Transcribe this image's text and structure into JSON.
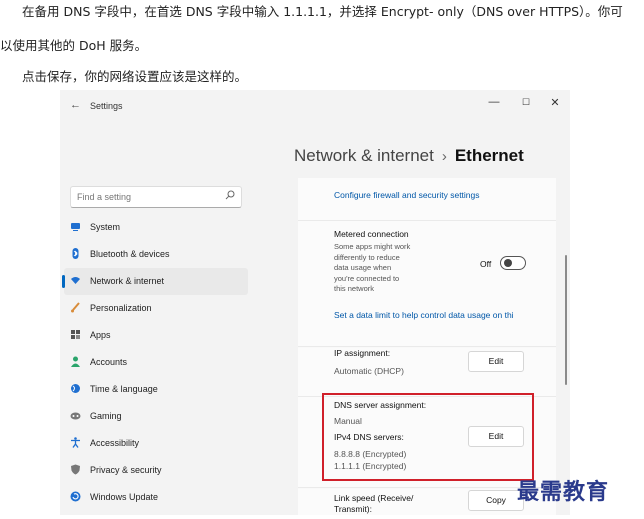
{
  "article": {
    "line1": "在备用 DNS 字段中，在首选 DNS 字段中输入 1.1.1.1，并选择 Encrypt- only（DNS over HTTPS）。你可",
    "line2": "以使用其他的 DoH 服务。",
    "line3": "点击保存，你的网络设置应该是这样的。"
  },
  "window": {
    "back_glyph": "←",
    "title": "Settings",
    "controls": {
      "minimize": "—",
      "maximize": "☐",
      "close": "✕"
    }
  },
  "breadcrumb": {
    "parent": "Network & internet",
    "separator": "›",
    "current": "Ethernet"
  },
  "search": {
    "placeholder": "Find a setting",
    "icon": "search-icon"
  },
  "sidebar": {
    "items": [
      {
        "label": "System",
        "icon": "system-icon",
        "color": "#1f6fd0"
      },
      {
        "label": "Bluetooth & devices",
        "icon": "bluetooth-icon",
        "color": "#1f6fd0"
      },
      {
        "label": "Network & internet",
        "icon": "wifi-icon",
        "color": "#1f6fd0",
        "active": true
      },
      {
        "label": "Personalization",
        "icon": "brush-icon",
        "color": "#d88c3a"
      },
      {
        "label": "Apps",
        "icon": "apps-icon",
        "color": "#555555"
      },
      {
        "label": "Accounts",
        "icon": "person-icon",
        "color": "#2aa46b"
      },
      {
        "label": "Time & language",
        "icon": "globe-icon",
        "color": "#1f6fd0"
      },
      {
        "label": "Gaming",
        "icon": "gamepad-icon",
        "color": "#777777"
      },
      {
        "label": "Accessibility",
        "icon": "accessibility-icon",
        "color": "#1f6fd0"
      },
      {
        "label": "Privacy & security",
        "icon": "shield-icon",
        "color": "#777777"
      },
      {
        "label": "Windows Update",
        "icon": "update-icon",
        "color": "#1f6fd0"
      }
    ]
  },
  "content": {
    "firewall_link": "Configure firewall and security settings",
    "metered": {
      "title": "Metered connection",
      "description_lines": [
        "Some apps might work",
        "differently to reduce",
        "data usage when",
        "you're connected to",
        "this network"
      ],
      "toggle_label": "Off",
      "toggle_on": false
    },
    "data_limit_link": "Set a data limit to help control data usage on thi",
    "ip": {
      "title": "IP assignment:",
      "value": "Automatic (DHCP)",
      "button": "Edit"
    },
    "dns": {
      "title": "DNS server assignment:",
      "value": "Manual",
      "ipv4_label": "IPv4 DNS servers:",
      "servers": [
        "8.8.8.8 (Encrypted)",
        "1.1.1.1 (Encrypted)"
      ],
      "button": "Edit"
    },
    "link_speed": {
      "title_lines": [
        "Link speed (Receive/",
        "Transmit):"
      ],
      "button": "Copy"
    }
  },
  "colors": {
    "accent": "#0067c0",
    "highlight": "#d0202a",
    "link": "#0057a8",
    "watermark": "#2a3a8c"
  },
  "watermark": "最需教育"
}
